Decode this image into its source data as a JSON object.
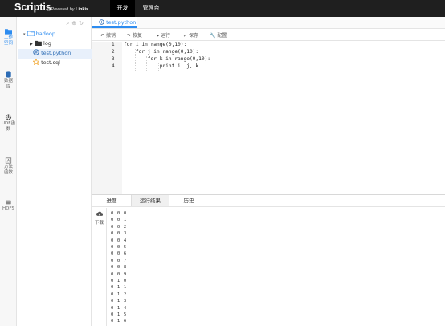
{
  "header": {
    "brand": "Scriptis",
    "brand_sub_prefix": "@Powered by ",
    "brand_sub_name": "Linkis",
    "nav": [
      {
        "label": "开发"
      },
      {
        "label": "管理台"
      }
    ]
  },
  "leftbar": {
    "items": [
      {
        "label": "工作\n空间",
        "icon": "folder-icon"
      },
      {
        "label": "数据\n库",
        "icon": "database-icon"
      },
      {
        "label": "UDF函\n数",
        "icon": "gear-icon"
      },
      {
        "label": "方法\n函数",
        "icon": "function-icon"
      },
      {
        "label": "HDFS",
        "icon": "hdfs-icon"
      }
    ]
  },
  "tree": {
    "root": "hadoop",
    "folder": "log",
    "files": [
      {
        "name": "test.python"
      },
      {
        "name": "test.sql"
      }
    ]
  },
  "editor": {
    "tab": "test.python",
    "toolbar": [
      {
        "label": "撤销",
        "icon": "undo-icon"
      },
      {
        "label": "恢复",
        "icon": "redo-icon"
      },
      {
        "label": "运行",
        "icon": "play-icon"
      },
      {
        "label": "保存",
        "icon": "check-icon"
      },
      {
        "label": "配置",
        "icon": "wrench-icon"
      }
    ],
    "lines": [
      {
        "num": "1",
        "code": "for i in range(0,10):"
      },
      {
        "num": "2",
        "code": "    for j in range(0,10):"
      },
      {
        "num": "3",
        "code": "        for k in range(0,10):"
      },
      {
        "num": "4",
        "code": "            print i, j, k"
      }
    ]
  },
  "results": {
    "tabs": [
      {
        "label": "进度"
      },
      {
        "label": "运行结果"
      },
      {
        "label": "历史"
      }
    ],
    "download_label": "下载",
    "output": [
      "0 0 0",
      "0 0 1",
      "0 0 2",
      "0 0 3",
      "0 0 4",
      "0 0 5",
      "0 0 6",
      "0 0 7",
      "0 0 8",
      "0 0 9",
      "0 1 0",
      "0 1 1",
      "0 1 2",
      "0 1 3",
      "0 1 4",
      "0 1 5",
      "0 1 6"
    ]
  }
}
